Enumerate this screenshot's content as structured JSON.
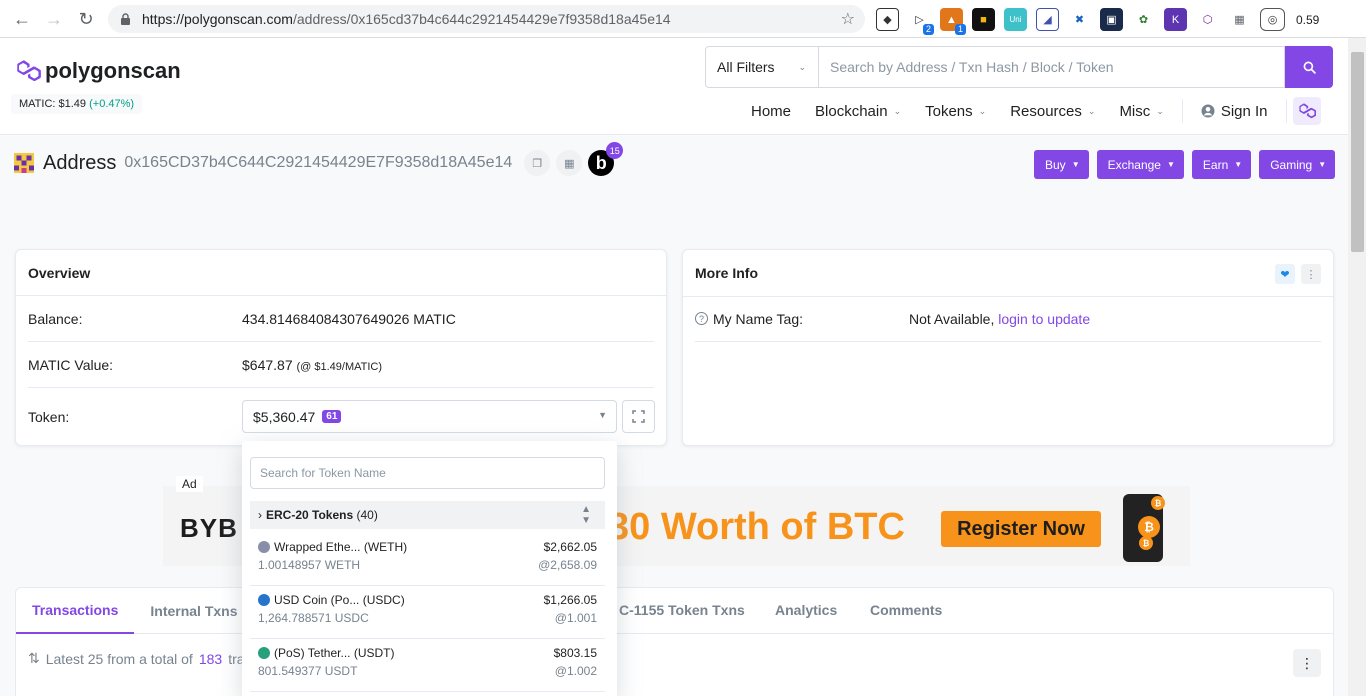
{
  "browser": {
    "url_host": "https://polygonscan.com",
    "url_path": "/address/0x165cd37b4c644c2921454429e7f9358d18a45e14",
    "ext_badge_1": "2",
    "ext_badge_2": "1",
    "ext_value": "0.59"
  },
  "header": {
    "brand": "polygonscan",
    "price_label": "MATIC: $1.49",
    "price_change": "(+0.47%)",
    "filter_label": "All Filters",
    "search_placeholder": "Search by Address / Txn Hash / Block / Token",
    "nav": {
      "home": "Home",
      "blockchain": "Blockchain",
      "tokens": "Tokens",
      "resources": "Resources",
      "misc": "Misc",
      "sign_in": "Sign In"
    }
  },
  "address": {
    "title": "Address",
    "hash": "0x165CD37b4C644C2921454429E7F9358d18A45e14",
    "badge_letter": "b",
    "badge_count": "15",
    "actions": {
      "buy": "Buy",
      "exchange": "Exchange",
      "earn": "Earn",
      "gaming": "Gaming"
    }
  },
  "overview": {
    "title": "Overview",
    "balance_label": "Balance:",
    "balance_value": "434.814684084307649026 MATIC",
    "value_label": "MATIC Value:",
    "value_amount": "$647.87",
    "value_rate": "(@ $1.49/MATIC)",
    "token_label": "Token:",
    "token_total": "$5,360.47",
    "token_count": "61"
  },
  "more_info": {
    "title": "More Info",
    "name_tag_label": "My Name Tag:",
    "name_tag_value": "Not Available,",
    "name_tag_link": "login to update"
  },
  "ad": {
    "tag": "Ad",
    "brand": "BYB",
    "headline": "30 Worth of BTC",
    "cta": "Register Now"
  },
  "tabs": {
    "transactions": "Transactions",
    "internal": "Internal Txns",
    "erc1155": "C-1155 Token Txns",
    "analytics": "Analytics",
    "comments": "Comments",
    "latest_prefix": "Latest 25 from a total of",
    "latest_count": "183",
    "latest_suffix": "tra"
  },
  "token_dropdown": {
    "search_placeholder": "Search for Token Name",
    "group_name": "ERC-20 Tokens",
    "group_count": "(40)",
    "items": [
      {
        "name": "Wrapped Ethe... (WETH)",
        "usd": "$2,662.05",
        "amount": "1.00148957 WETH",
        "rate": "@2,658.09",
        "icon_color": "#8a8fa8"
      },
      {
        "name": "USD Coin (Po... (USDC)",
        "usd": "$1,266.05",
        "amount": "1,264.788571 USDC",
        "rate": "@1.001",
        "icon_color": "#2775ca"
      },
      {
        "name": "(PoS) Tether... (USDT)",
        "usd": "$803.15",
        "amount": "801.549377 USDT",
        "rate": "@1.002",
        "icon_color": "#26a17b"
      }
    ]
  },
  "colors": {
    "accent": "#8247e5",
    "positive": "#00a186",
    "ad_orange": "#f7931a"
  }
}
